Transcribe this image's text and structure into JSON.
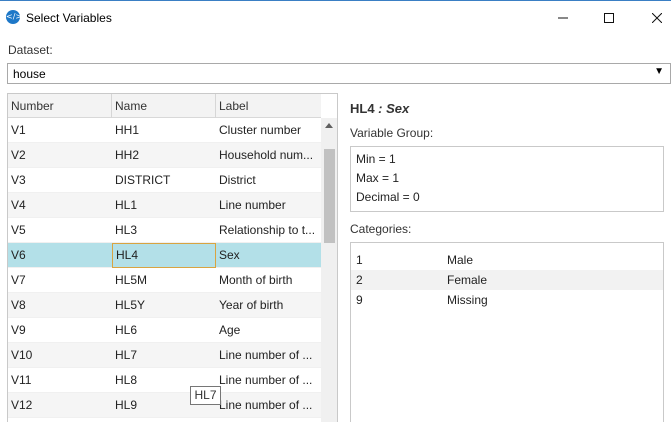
{
  "window": {
    "title": "Select Variables",
    "icon": "code-brackets-icon"
  },
  "dataset": {
    "label": "Dataset:",
    "value": "house"
  },
  "table": {
    "columns": [
      "Number",
      "Name",
      "Label"
    ],
    "rows": [
      {
        "number": "V1",
        "name": "HH1",
        "label": "Cluster number"
      },
      {
        "number": "V2",
        "name": "HH2",
        "label": "Household num..."
      },
      {
        "number": "V3",
        "name": "DISTRICT",
        "label": "District"
      },
      {
        "number": "V4",
        "name": "HL1",
        "label": "Line number"
      },
      {
        "number": "V5",
        "name": "HL3",
        "label": "Relationship to t..."
      },
      {
        "number": "V6",
        "name": "HL4",
        "label": "Sex"
      },
      {
        "number": "V7",
        "name": "HL5M",
        "label": "Month of birth"
      },
      {
        "number": "V8",
        "name": "HL5Y",
        "label": "Year of birth"
      },
      {
        "number": "V9",
        "name": "HL6",
        "label": "Age"
      },
      {
        "number": "V10",
        "name": "HL7",
        "label": "Line number of ..."
      },
      {
        "number": "V11",
        "name": "HL8",
        "label": "Line number of ..."
      },
      {
        "number": "V12",
        "name": "HL9",
        "label": "Line number of ..."
      }
    ],
    "selected_row": 5,
    "tooltip": "HL7"
  },
  "detail": {
    "name": "HL4",
    "separator": " : ",
    "label": "Sex",
    "variable_group_label": "Variable Group:",
    "stats": [
      "Min = 1",
      "Max = 1",
      "Decimal = 0"
    ],
    "categories_label": "Categories:",
    "categories": [
      {
        "code": "1",
        "label": "Male"
      },
      {
        "code": "2",
        "label": "Female"
      },
      {
        "code": "9",
        "label": "Missing"
      }
    ]
  },
  "colors": {
    "selected_row": "#b3e0e8",
    "focus_border": "#d9a441",
    "app_icon": "#1e78c8"
  }
}
